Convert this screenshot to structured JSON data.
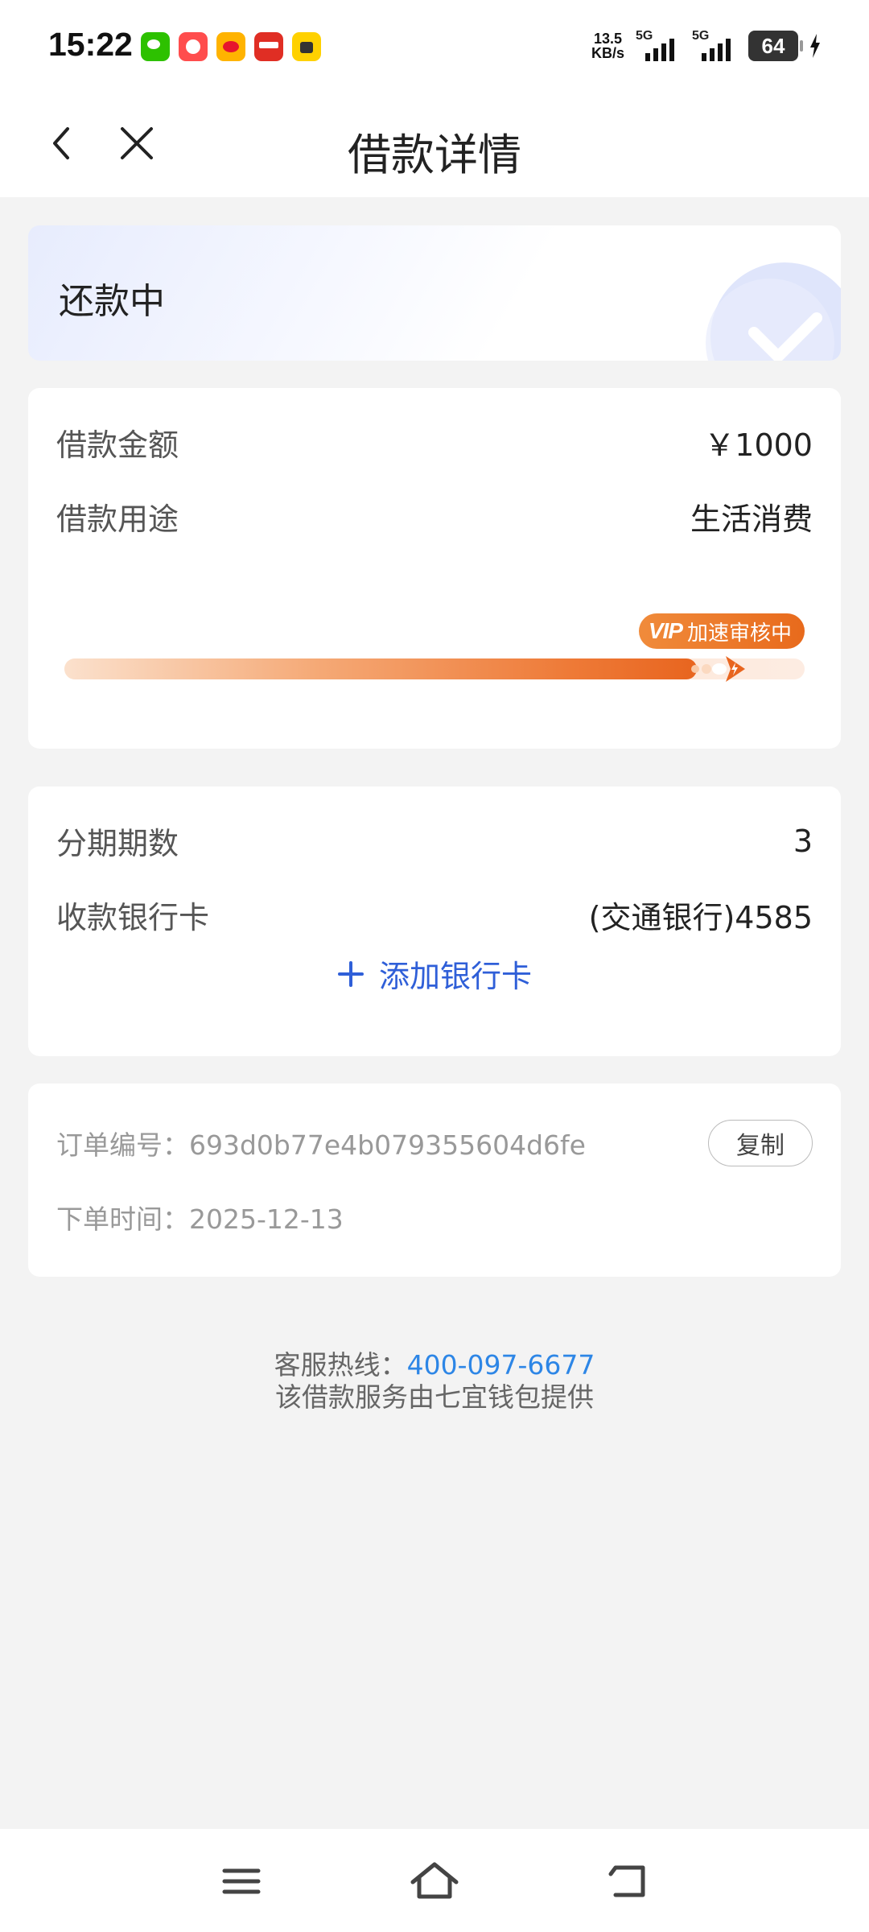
{
  "status_bar": {
    "time": "15:22",
    "net_speed_value": "13.5",
    "net_speed_unit": "KB/s",
    "signal1_label": "5G",
    "signal2_label": "5G",
    "battery": "64",
    "app_icons": [
      "wechat-icon",
      "clown-app-icon",
      "weibo-icon",
      "pinduoduo-icon",
      "meituan-icon"
    ]
  },
  "header": {
    "title": "借款详情"
  },
  "status_card": {
    "status": "还款中"
  },
  "loan_info": {
    "amount_label": "借款金额",
    "amount_value": "￥1000",
    "purpose_label": "借款用途",
    "purpose_value": "生活消费",
    "progress_fraction": 0.92,
    "vip_text": "VIP",
    "badge_text": "加速审核中"
  },
  "installment": {
    "periods_label": "分期期数",
    "periods_value": "3",
    "bank_label": "收款银行卡",
    "bank_value": "(交通银行)4585",
    "add_card_label": "添加银行卡"
  },
  "order": {
    "number_label": "订单编号：",
    "number_value": "693d0b77e4b079355604d6fe",
    "copy_label": "复制",
    "time_label": "下单时间：",
    "time_value": "2025-12-13"
  },
  "footer": {
    "hotline_label": "客服热线：",
    "hotline_number": "400-097-6677",
    "provider_text": "该借款服务由七宜钱包提供"
  },
  "colors": {
    "accent_blue": "#2f5fd8",
    "link_blue": "#2d86e6",
    "progress_orange": "#e8651f"
  }
}
